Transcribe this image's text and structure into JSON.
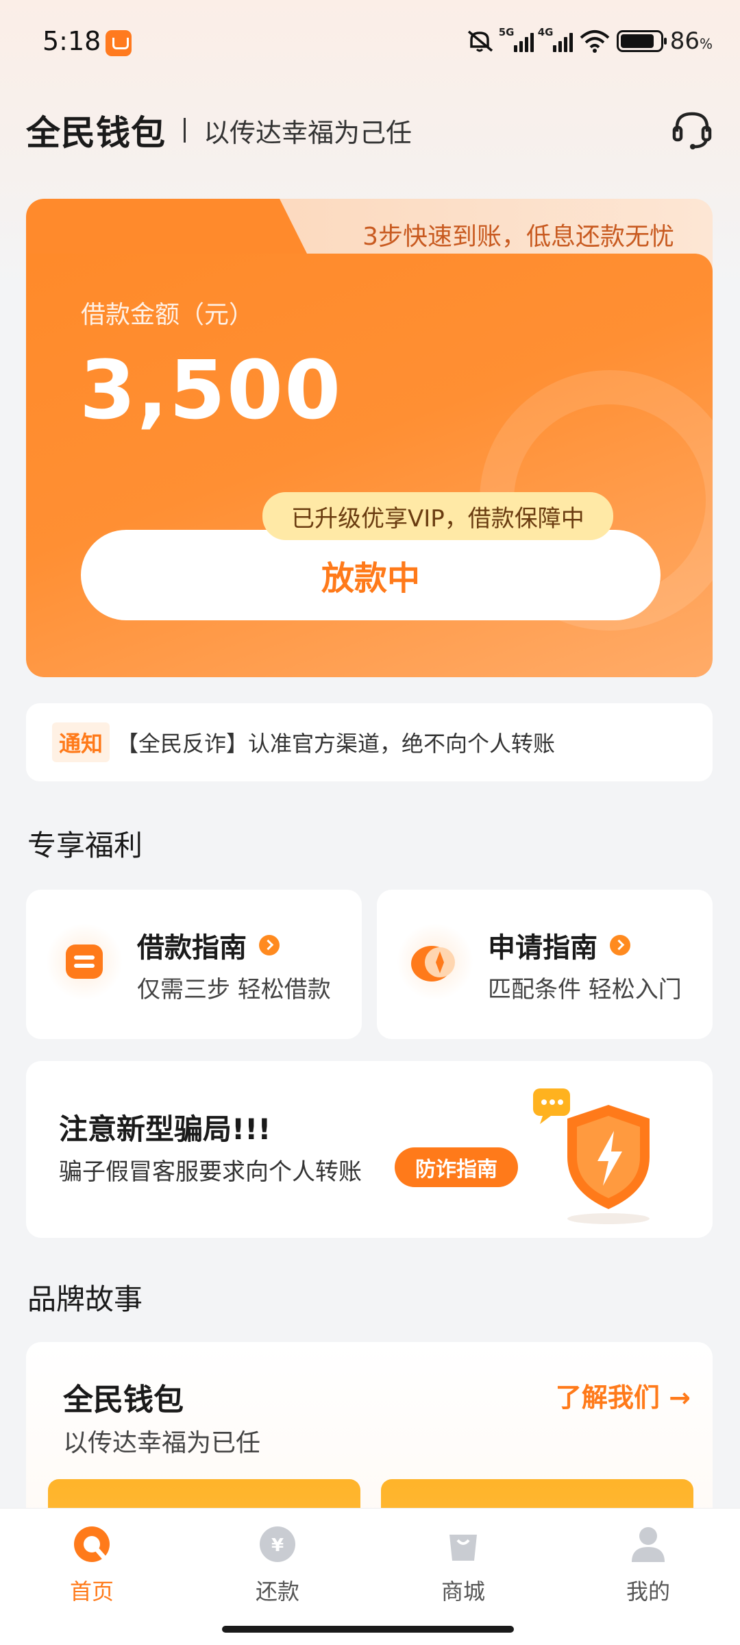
{
  "status_bar": {
    "time": "5:18",
    "signal1_tag": "5G",
    "signal2_tag": "4G",
    "battery_percent": "86",
    "battery_unit": "%",
    "battery_level": 0.86
  },
  "header": {
    "brand": "全民钱包",
    "slogan": "以传达幸福为己任",
    "support_icon": "headset-icon"
  },
  "loan_card": {
    "promo": "3步快速到账，低息还款无忧",
    "amount_label": "借款金额（元）",
    "amount": "3,500",
    "vip_badge": "已升级优享VIP，借款保障中",
    "status_button": "放款中"
  },
  "notice": {
    "tag": "通知",
    "text": "【全民反诈】认准官方渠道，绝不向个人转账"
  },
  "benefits": {
    "section_title": "专享福利",
    "items": [
      {
        "title": "借款指南",
        "subtitle": "仅需三步 轻松借款",
        "icon": "loan-guide-icon"
      },
      {
        "title": "申请指南",
        "subtitle": "匹配条件 轻松入门",
        "icon": "compass-icon"
      }
    ]
  },
  "fraud_alert": {
    "title": "注意新型骗局!!!",
    "subtitle": "骗子假冒客服要求向个人转账",
    "button": "防诈指南",
    "icon": "shield-lightning-icon"
  },
  "brand_story": {
    "section_title": "品牌故事",
    "title": "全民钱包",
    "subtitle": "以传达幸福为已任",
    "link": "了解我们 →"
  },
  "tab_bar": {
    "active_color": "#ff7a1a",
    "items": [
      {
        "label": "首页",
        "icon": "home-icon",
        "active": true
      },
      {
        "label": "还款",
        "icon": "yen-coin-icon",
        "active": false
      },
      {
        "label": "商城",
        "icon": "shopping-bag-icon",
        "active": false
      },
      {
        "label": "我的",
        "icon": "user-icon",
        "active": false
      }
    ]
  }
}
